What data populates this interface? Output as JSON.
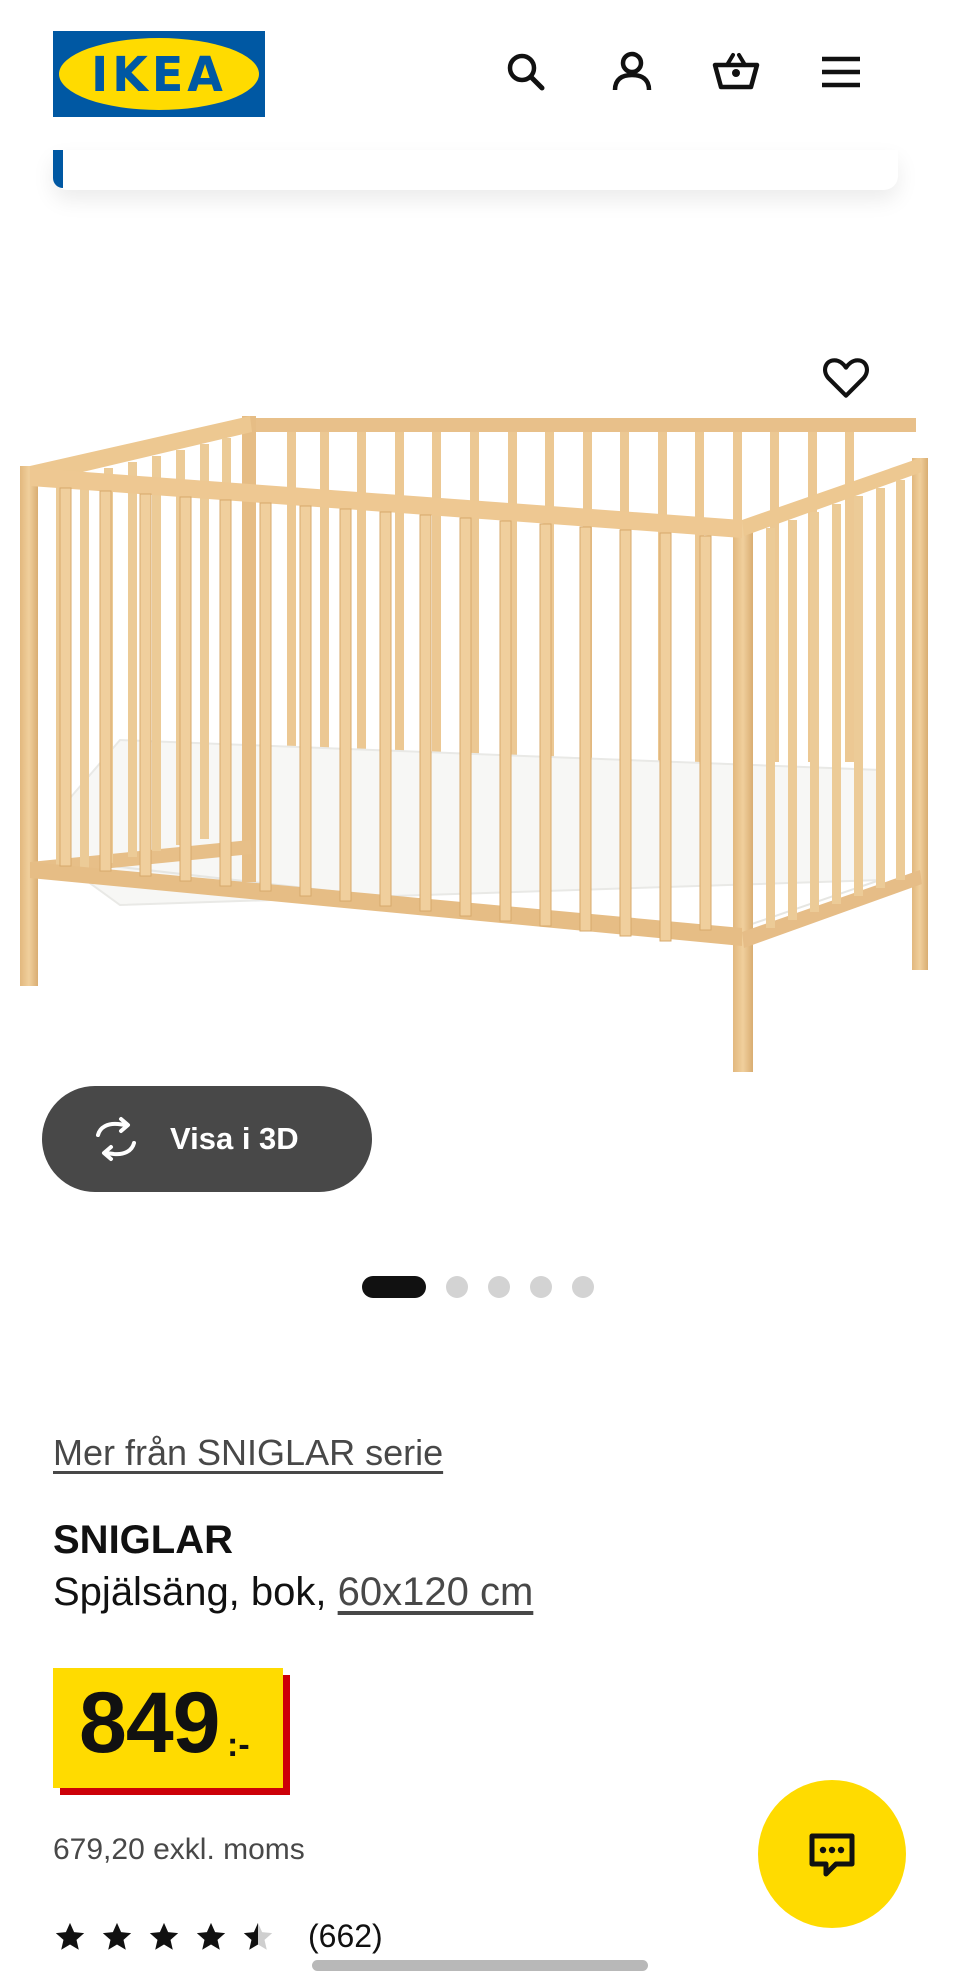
{
  "header": {
    "logo_text": "IKEA",
    "icons": [
      "search-icon",
      "account-icon",
      "basket-icon",
      "menu-icon"
    ]
  },
  "product": {
    "gallery": {
      "view_3d_label": "Visa i 3D",
      "image_count": 5,
      "active_index": 0
    },
    "series_link": "Mer från SNIGLAR serie",
    "name": "SNIGLAR",
    "description": "Spjälsäng, bok,",
    "size_link": "60x120 cm",
    "price": {
      "amount": "849",
      "suffix": ":-",
      "excl_vat": "679,20 exkl. moms"
    },
    "rating": {
      "stars": 4.5,
      "count": "(662)"
    }
  },
  "colors": {
    "brand_blue": "#0058a3",
    "brand_yellow": "#ffdb00",
    "price_shadow_red": "#cc0008",
    "dark_button": "#484848"
  }
}
